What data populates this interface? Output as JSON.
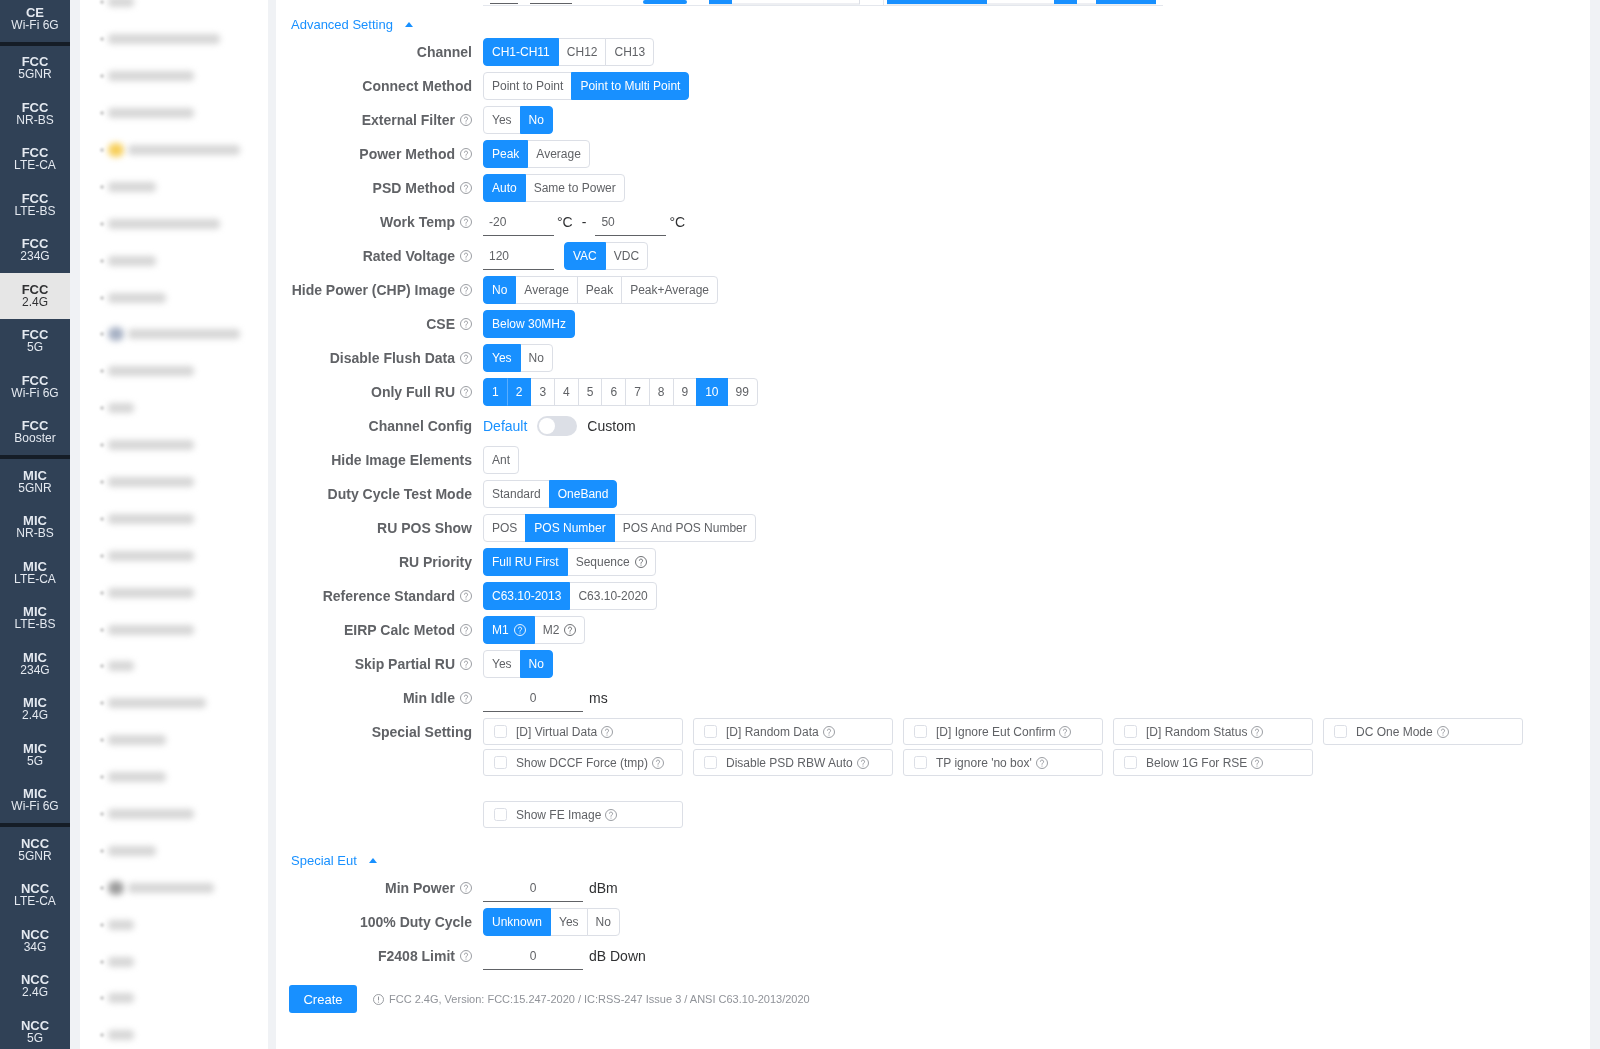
{
  "sidebar": {
    "groups": [
      {
        "items": [
          {
            "name": "CE",
            "band": "Wi-Fi 6G",
            "selected": false
          }
        ]
      },
      {
        "items": [
          {
            "name": "FCC",
            "band": "5GNR",
            "selected": false
          },
          {
            "name": "FCC",
            "band": "NR-BS",
            "selected": false
          },
          {
            "name": "FCC",
            "band": "LTE-CA",
            "selected": false
          },
          {
            "name": "FCC",
            "band": "LTE-BS",
            "selected": false
          },
          {
            "name": "FCC",
            "band": "234G",
            "selected": false
          },
          {
            "name": "FCC",
            "band": "2.4G",
            "selected": true
          },
          {
            "name": "FCC",
            "band": "5G",
            "selected": false
          },
          {
            "name": "FCC",
            "band": "Wi-Fi 6G",
            "selected": false
          },
          {
            "name": "FCC",
            "band": "Booster",
            "selected": false
          }
        ]
      },
      {
        "items": [
          {
            "name": "MIC",
            "band": "5GNR",
            "selected": false
          },
          {
            "name": "MIC",
            "band": "NR-BS",
            "selected": false
          },
          {
            "name": "MIC",
            "band": "LTE-CA",
            "selected": false
          },
          {
            "name": "MIC",
            "band": "LTE-BS",
            "selected": false
          },
          {
            "name": "MIC",
            "band": "234G",
            "selected": false
          },
          {
            "name": "MIC",
            "band": "2.4G",
            "selected": false
          },
          {
            "name": "MIC",
            "band": "5G",
            "selected": false
          },
          {
            "name": "MIC",
            "band": "Wi-Fi 6G",
            "selected": false
          }
        ]
      },
      {
        "items": [
          {
            "name": "NCC",
            "band": "5GNR",
            "selected": false
          },
          {
            "name": "NCC",
            "band": "LTE-CA",
            "selected": false
          },
          {
            "name": "NCC",
            "band": "34G",
            "selected": false
          },
          {
            "name": "NCC",
            "band": "2.4G",
            "selected": false
          },
          {
            "name": "NCC",
            "band": "5G",
            "selected": false
          }
        ]
      }
    ]
  },
  "sections": [
    {
      "title": "Advanced Setting",
      "expanded": true,
      "fields": [
        {
          "kind": "segmented",
          "label": "Channel",
          "help": false,
          "options": [
            {
              "label": "CH1-CH11",
              "selected": true
            },
            {
              "label": "CH12",
              "selected": false
            },
            {
              "label": "CH13",
              "selected": false
            }
          ]
        },
        {
          "kind": "segmented",
          "label": "Connect Method",
          "help": false,
          "options": [
            {
              "label": "Point to Point",
              "selected": false
            },
            {
              "label": "Point to Multi Point",
              "selected": true
            }
          ]
        },
        {
          "kind": "segmented",
          "label": "External Filter",
          "help": true,
          "options": [
            {
              "label": "Yes",
              "selected": false
            },
            {
              "label": "No",
              "selected": true
            }
          ]
        },
        {
          "kind": "segmented",
          "label": "Power Method",
          "help": true,
          "options": [
            {
              "label": "Peak",
              "selected": true
            },
            {
              "label": "Average",
              "selected": false
            }
          ]
        },
        {
          "kind": "segmented",
          "label": "PSD Method",
          "help": true,
          "options": [
            {
              "label": "Auto",
              "selected": true
            },
            {
              "label": "Same to Power",
              "selected": false
            }
          ]
        },
        {
          "kind": "range",
          "label": "Work Temp",
          "help": true,
          "from": {
            "value": "-20",
            "unit": "°C"
          },
          "separator": "-",
          "to": {
            "value": "50",
            "unit": "°C"
          }
        },
        {
          "kind": "input_segmented",
          "label": "Rated Voltage",
          "help": true,
          "value": "120",
          "options": [
            {
              "label": "VAC",
              "selected": true
            },
            {
              "label": "VDC",
              "selected": false
            }
          ]
        },
        {
          "kind": "segmented",
          "label": "Hide Power (CHP) Image",
          "help": true,
          "options": [
            {
              "label": "No",
              "selected": true
            },
            {
              "label": "Average",
              "selected": false
            },
            {
              "label": "Peak",
              "selected": false
            },
            {
              "label": "Peak+Average",
              "selected": false
            }
          ]
        },
        {
          "kind": "segmented",
          "label": "CSE",
          "help": true,
          "options": [
            {
              "label": "Below 30MHz",
              "selected": true
            }
          ]
        },
        {
          "kind": "segmented",
          "label": "Disable Flush Data",
          "help": true,
          "options": [
            {
              "label": "Yes",
              "selected": true
            },
            {
              "label": "No",
              "selected": false
            }
          ]
        },
        {
          "kind": "segmented",
          "label": "Only Full RU",
          "help": true,
          "options": [
            {
              "label": "1",
              "selected": true
            },
            {
              "label": "2",
              "selected": true
            },
            {
              "label": "3",
              "selected": false
            },
            {
              "label": "4",
              "selected": false
            },
            {
              "label": "5",
              "selected": false
            },
            {
              "label": "6",
              "selected": false
            },
            {
              "label": "7",
              "selected": false
            },
            {
              "label": "8",
              "selected": false
            },
            {
              "label": "9",
              "selected": false
            },
            {
              "label": "10",
              "selected": true
            },
            {
              "label": "99",
              "selected": false
            }
          ]
        },
        {
          "kind": "switch",
          "label": "Channel Config",
          "help": false,
          "off_label": "Default",
          "on_label": "Custom",
          "on": false
        },
        {
          "kind": "segmented",
          "label": "Hide Image Elements",
          "help": false,
          "options": [
            {
              "label": "Ant",
              "selected": false
            }
          ]
        },
        {
          "kind": "segmented",
          "label": "Duty Cycle Test Mode",
          "help": false,
          "options": [
            {
              "label": "Standard",
              "selected": false
            },
            {
              "label": "OneBand",
              "selected": true
            }
          ]
        },
        {
          "kind": "segmented",
          "label": "RU POS Show",
          "help": false,
          "options": [
            {
              "label": "POS",
              "selected": false
            },
            {
              "label": "POS Number",
              "selected": true
            },
            {
              "label": "POS And POS Number",
              "selected": false
            }
          ]
        },
        {
          "kind": "segmented",
          "label": "RU Priority",
          "help": false,
          "options": [
            {
              "label": "Full RU First",
              "selected": true,
              "help": false
            },
            {
              "label": "Sequence",
              "selected": false,
              "help": true
            }
          ]
        },
        {
          "kind": "segmented",
          "label": "Reference Standard",
          "help": true,
          "options": [
            {
              "label": "C63.10-2013",
              "selected": true
            },
            {
              "label": "C63.10-2020",
              "selected": false
            }
          ]
        },
        {
          "kind": "segmented",
          "label": "EIRP Calc Metod",
          "help": true,
          "options": [
            {
              "label": "M1",
              "selected": true,
              "help": true
            },
            {
              "label": "M2",
              "selected": false,
              "help": true
            }
          ]
        },
        {
          "kind": "segmented",
          "label": "Skip Partial RU",
          "help": true,
          "options": [
            {
              "label": "Yes",
              "selected": false
            },
            {
              "label": "No",
              "selected": true
            }
          ]
        },
        {
          "kind": "input",
          "label": "Min Idle",
          "help": true,
          "value": "0",
          "unit": "ms"
        },
        {
          "kind": "checkboxes",
          "label": "Special Setting",
          "help": false,
          "groups": [
            {
              "items": [
                {
                  "label": "[D] Virtual Data",
                  "checked": false,
                  "help": true
                },
                {
                  "label": "[D] Random Data",
                  "checked": false,
                  "help": true
                },
                {
                  "label": "[D] Ignore Eut Confirm",
                  "checked": false,
                  "help": true
                },
                {
                  "label": "[D] Random Status",
                  "checked": false,
                  "help": true
                },
                {
                  "label": "DC One Mode",
                  "checked": false,
                  "help": true
                },
                {
                  "label": "Show DCCF Force (tmp)",
                  "checked": false,
                  "help": true
                },
                {
                  "label": "Disable PSD RBW Auto",
                  "checked": false,
                  "help": true
                },
                {
                  "label": "TP ignore 'no box'",
                  "checked": false,
                  "help": true
                },
                {
                  "label": "Below 1G For RSE",
                  "checked": false,
                  "help": true
                }
              ]
            },
            {
              "items": [
                {
                  "label": "Show FE Image",
                  "checked": false,
                  "help": true
                }
              ]
            }
          ]
        }
      ]
    },
    {
      "title": "Special Eut",
      "expanded": true,
      "fields": [
        {
          "kind": "input",
          "label": "Min Power",
          "help": true,
          "value": "0",
          "unit": "dBm"
        },
        {
          "kind": "segmented",
          "label": "100% Duty Cycle",
          "help": false,
          "options": [
            {
              "label": "Unknown",
              "selected": true
            },
            {
              "label": "Yes",
              "selected": false
            },
            {
              "label": "No",
              "selected": false
            }
          ]
        },
        {
          "kind": "input",
          "label": "F2408 Limit",
          "help": true,
          "value": "0",
          "unit": "dB Down"
        }
      ]
    }
  ],
  "create_button": "Create",
  "version_note": "FCC 2.4G, Version: FCC:15.247-2020 / IC:RSS-247 Issue 3 / ANSI C63.10-2013/2020"
}
